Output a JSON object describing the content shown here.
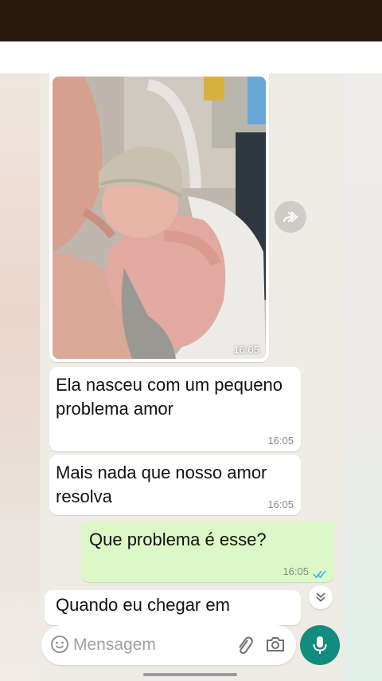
{
  "colors": {
    "top_bar": "#2a1a0c",
    "chat_background": "#efebe5",
    "incoming_bubble": "#ffffff",
    "outgoing_bubble": "#dcf8c6",
    "read_ticks": "#34b7f1",
    "mic_button": "#128c7e"
  },
  "messages": [
    {
      "type": "image",
      "direction": "incoming",
      "time": "16:05"
    },
    {
      "type": "text",
      "direction": "incoming",
      "text": "Ela nasceu com um pequeno problema amor",
      "time": "16:05"
    },
    {
      "type": "text",
      "direction": "incoming",
      "text": "Mais nada que nosso amor resolva",
      "time": "16:05"
    },
    {
      "type": "text",
      "direction": "outgoing",
      "text": "Que problema é esse?",
      "time": "16:05",
      "status": "read"
    },
    {
      "type": "text",
      "direction": "incoming",
      "text": "Quando eu chegar em"
    }
  ],
  "composer": {
    "placeholder": "Mensagem",
    "value": ""
  },
  "icons": {
    "forward": "forward-icon",
    "scroll_down": "double-chevron-down-icon",
    "emoji": "emoji-icon",
    "attach": "paperclip-icon",
    "camera": "camera-icon",
    "mic": "microphone-icon",
    "read_status": "double-check-icon"
  }
}
